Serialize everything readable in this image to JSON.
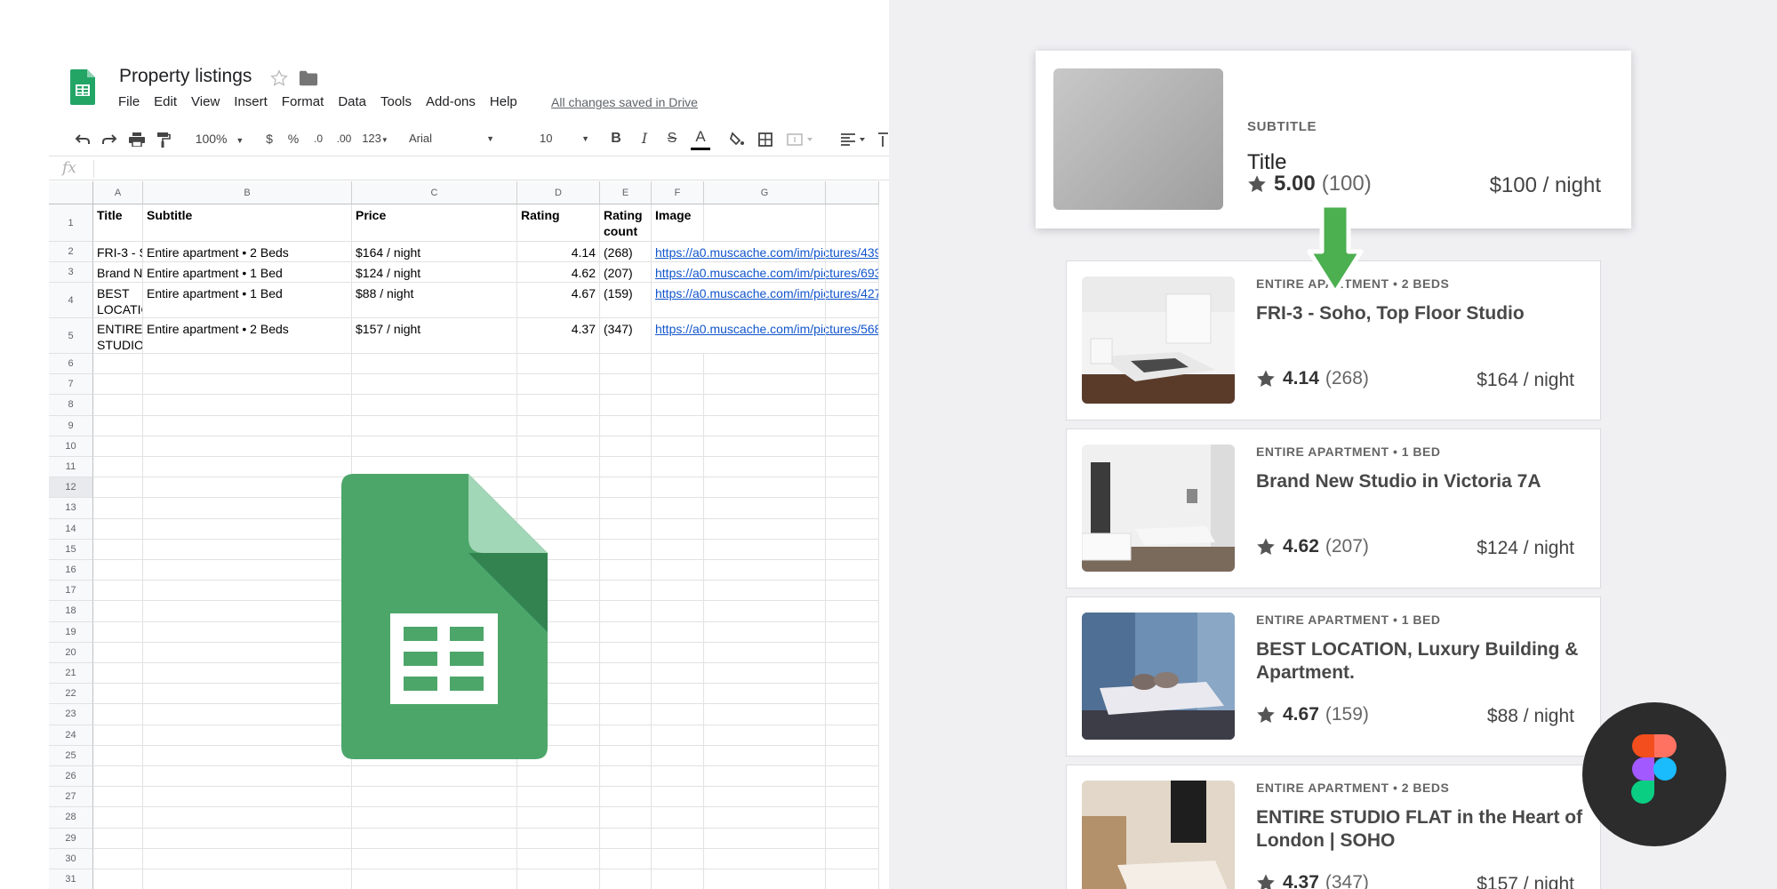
{
  "sheets": {
    "doc_title": "Property listings",
    "menu": [
      "File",
      "Edit",
      "View",
      "Insert",
      "Format",
      "Data",
      "Tools",
      "Add-ons",
      "Help"
    ],
    "save_status": "All changes saved in Drive",
    "toolbar": {
      "zoom": "100%",
      "currency": "$",
      "percent": "%",
      "decrease_decimals": ".0",
      "increase_decimals": ".00",
      "more_formats": "123",
      "font": "Arial",
      "font_size": "10",
      "bold": "B",
      "italic": "I",
      "strikethrough": "S",
      "text_color": "A"
    },
    "fx_label": "fx",
    "columns": [
      "A",
      "B",
      "C",
      "D",
      "E",
      "F",
      "G"
    ],
    "header_row": [
      "Title",
      "Subtitle",
      "Price",
      "Rating",
      "Rating count",
      "Image"
    ],
    "rows": [
      [
        "FRI-3 - Soho, Top Floor Studio",
        "Entire apartment • 2 Beds",
        "$164 / night",
        "4.14",
        "(268)",
        "https://a0.muscache.com/im/pictures/4399"
      ],
      [
        "Brand New Studio in Victoria 7A",
        "Entire apartment • 1 Bed",
        "$124 / night",
        "4.62",
        "(207)",
        "https://a0.muscache.com/im/pictures/6934"
      ],
      [
        "BEST LOCATION, Luxury Building & Apartment.",
        "Entire apartment • 1 Bed",
        "$88 / night",
        "4.67",
        "(159)",
        "https://a0.muscache.com/im/pictures/4274"
      ],
      [
        "ENTIRE STUDIO FLAT in the Heart of London | SOHO",
        "Entire apartment • 2 Beds",
        "$157 / night",
        "4.37",
        "(347)",
        "https://a0.muscache.com/im/pictures/5688"
      ]
    ],
    "row_numbers": [
      "1",
      "2",
      "3",
      "4",
      "5",
      "6",
      "7",
      "8",
      "9",
      "10",
      "11",
      "12",
      "13",
      "14",
      "15",
      "16",
      "17",
      "18",
      "19",
      "20",
      "21",
      "22",
      "23",
      "24",
      "25",
      "26",
      "27",
      "28",
      "29",
      "30",
      "31"
    ],
    "selected_row": "12"
  },
  "template": {
    "subtitle": "SUBTITLE",
    "title": "Title",
    "rating": "5.00",
    "rating_count": "(100)",
    "price": "$100 / night"
  },
  "listings": [
    {
      "subtitle": "ENTIRE APARTMENT • 2 BEDS",
      "title": "FRI-3 - Soho, Top Floor Studio",
      "rating": "4.14",
      "rating_count": "(268)",
      "price": "$164 / night"
    },
    {
      "subtitle": "ENTIRE APARTMENT • 1 BED",
      "title": "Brand New Studio in Victoria 7A",
      "rating": "4.62",
      "rating_count": "(207)",
      "price": "$124 / night"
    },
    {
      "subtitle": "ENTIRE APARTMENT • 1 BED",
      "title": "BEST LOCATION, Luxury Building & Apartment.",
      "rating": "4.67",
      "rating_count": "(159)",
      "price": "$88 / night"
    },
    {
      "subtitle": "ENTIRE APARTMENT • 2 BEDS",
      "title": "ENTIRE STUDIO FLAT in the Heart of London | SOHO",
      "rating": "4.37",
      "rating_count": "(347)",
      "price": "$157 / night"
    }
  ],
  "colors": {
    "sheets_green": "#4ca66a",
    "sheets_dark_green": "#2f7d4c",
    "link_blue": "#1155cc",
    "arrow_green": "#4caf50",
    "star_gray": "#555555",
    "figma_red": "#f24e1e",
    "figma_orange": "#ff7262",
    "figma_purple": "#a259ff",
    "figma_blue": "#1abcfe",
    "figma_green": "#0acf83"
  }
}
